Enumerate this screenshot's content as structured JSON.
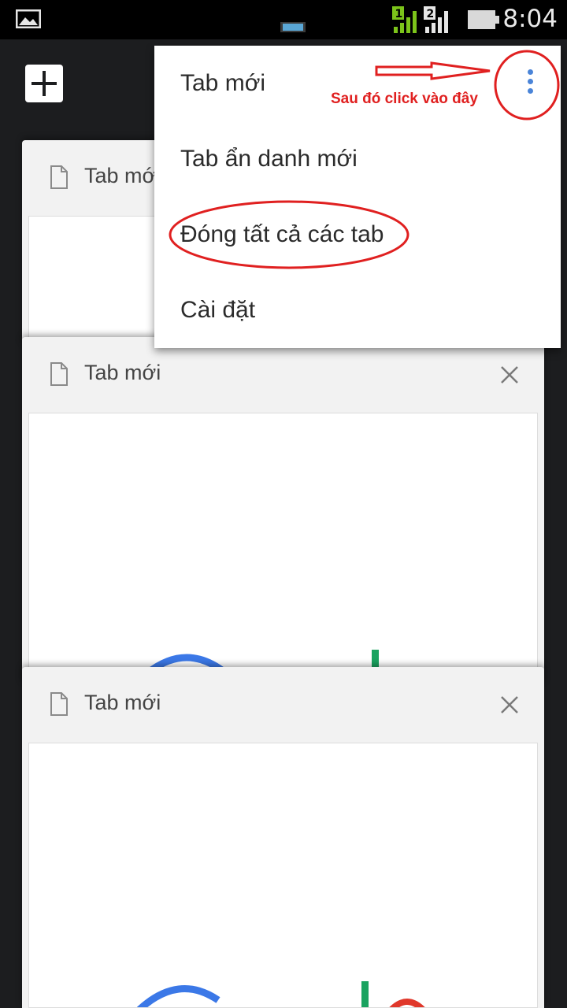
{
  "status_bar": {
    "time": "8:04",
    "sim1_label": "1",
    "sim2_label": "2",
    "icons": [
      "picture-icon",
      "media-icon",
      "signal-sim1-icon",
      "signal-sim2-icon",
      "battery-icon"
    ]
  },
  "toolbar": {
    "new_tab_icon": "plus-icon"
  },
  "tabs": [
    {
      "title": "Tab mới"
    },
    {
      "title": "Tab mới",
      "close_icon": "close-icon"
    },
    {
      "title": "Tab mới",
      "close_icon": "close-icon"
    }
  ],
  "menu": {
    "items": [
      {
        "label": "Tab mới"
      },
      {
        "label": "Tab ẩn danh mới"
      },
      {
        "label": "Đóng tất cả các tab"
      },
      {
        "label": "Cài đặt"
      }
    ],
    "overflow_icon": "more-vertical-icon"
  },
  "annotation": {
    "text": "Sau đó click vào đây",
    "color": "#e02020"
  },
  "colors": {
    "menu_dots": "#4a84d8",
    "status_green": "#7cc41a",
    "background": "#1c1d1f"
  }
}
